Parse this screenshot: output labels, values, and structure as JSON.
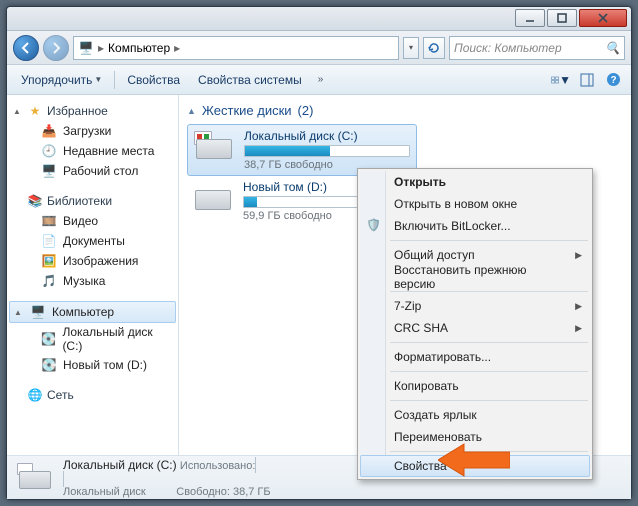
{
  "breadcrumb": {
    "root_icon": "computer",
    "path": "Компьютер",
    "sep": "▸"
  },
  "search": {
    "placeholder": "Поиск: Компьютер"
  },
  "toolbar": {
    "organize": "Упорядочить",
    "properties": "Свойства",
    "system_properties": "Свойства системы"
  },
  "sidebar": {
    "favorites": {
      "label": "Избранное",
      "items": [
        "Загрузки",
        "Недавние места",
        "Рабочий стол"
      ]
    },
    "libraries": {
      "label": "Библиотеки",
      "items": [
        "Видео",
        "Документы",
        "Изображения",
        "Музыка"
      ]
    },
    "computer": {
      "label": "Компьютер",
      "items": [
        "Локальный диск (C:)",
        "Новый том (D:)"
      ]
    },
    "network": {
      "label": "Сеть"
    }
  },
  "content": {
    "group_label": "Жесткие диски",
    "group_count": "(2)",
    "drives": [
      {
        "name": "Локальный диск (C:)",
        "free": "38,7 ГБ свободно",
        "fill_percent": 52
      },
      {
        "name": "Новый том (D:)",
        "free": "59,9 ГБ свободно",
        "fill_percent": 8
      }
    ]
  },
  "context_menu": {
    "open": "Открыть",
    "open_new": "Открыть в новом окне",
    "bitlocker": "Включить BitLocker...",
    "share": "Общий доступ",
    "restore": "Восстановить прежнюю версию",
    "sevenzip": "7-Zip",
    "crcsha": "CRC SHA",
    "format": "Форматировать...",
    "copy": "Копировать",
    "shortcut": "Создать ярлык",
    "rename": "Переименовать",
    "properties": "Свойства"
  },
  "status": {
    "title": "Локальный диск (C:)",
    "subtitle": "Локальный диск",
    "used_label": "Использовано:",
    "free_label": "Свободно:",
    "free_value": "38,7 ГБ",
    "fill_percent": 52
  }
}
